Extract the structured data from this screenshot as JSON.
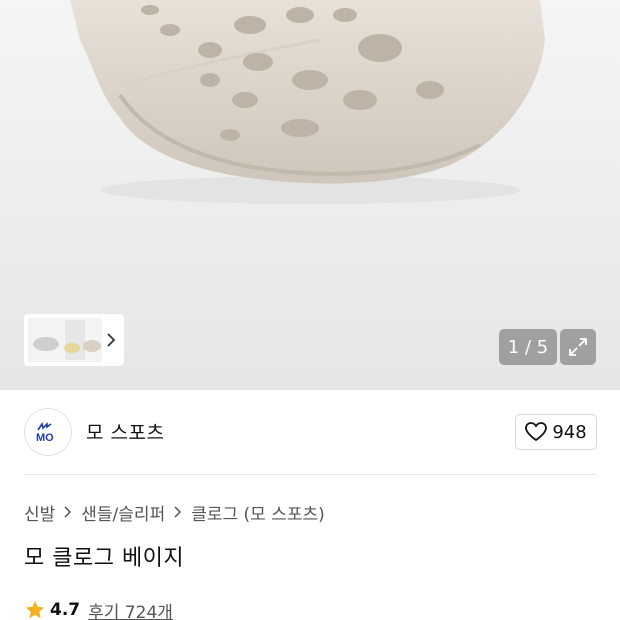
{
  "gallery": {
    "counter_text": "1 / 5",
    "current_index": 1,
    "total_images": 5,
    "expand_icon": "expand-icon",
    "thumbnail_next_icon": "chevron-right-icon"
  },
  "brand": {
    "logo_text": "MO",
    "name": "모 스포츠",
    "like_count": "948",
    "like_icon": "heart-icon"
  },
  "breadcrumb": [
    {
      "label": "신발"
    },
    {
      "label": "샌들/슬리퍼"
    },
    {
      "label": "클로그 (모 스포츠)"
    }
  ],
  "product": {
    "title": "모 클로그 베이지",
    "rating": "4.7",
    "review_label": "후기 724개"
  },
  "colors": {
    "accent_star": "#f2b01e",
    "brand_logo": "#1e3ea8",
    "counter_bg": "#9a9a9a"
  }
}
